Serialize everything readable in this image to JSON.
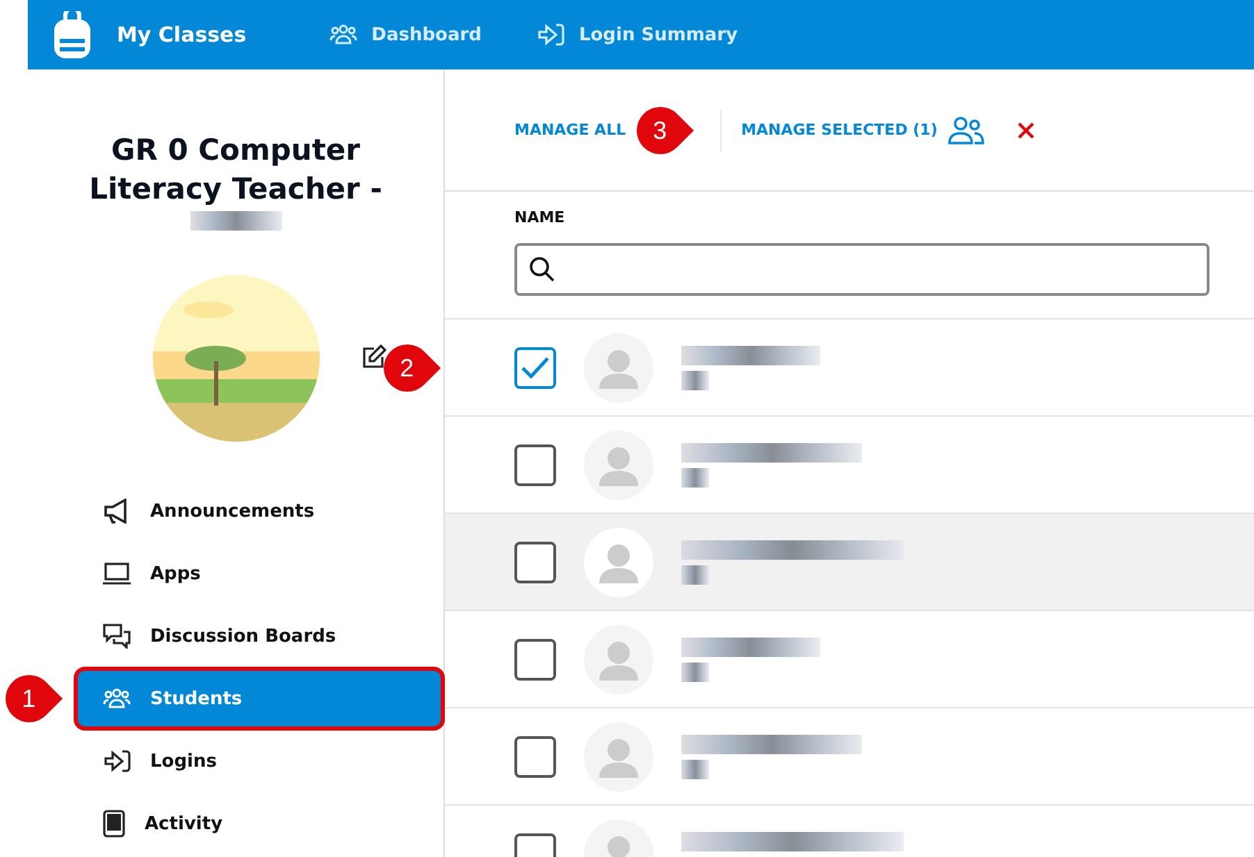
{
  "top_nav": {
    "title": "My Classes",
    "links": [
      {
        "label": "Dashboard"
      },
      {
        "label": "Login Summary"
      }
    ]
  },
  "sidebar": {
    "class_title": "GR 0 Computer Literacy Teacher -",
    "items": [
      {
        "label": "Announcements",
        "selected": false
      },
      {
        "label": "Apps",
        "selected": false
      },
      {
        "label": "Discussion Boards",
        "selected": false
      },
      {
        "label": "Students",
        "selected": true,
        "callout": "1"
      },
      {
        "label": "Logins",
        "selected": false
      },
      {
        "label": "Activity",
        "selected": false
      }
    ]
  },
  "toolbar": {
    "manage_all": "MANAGE ALL",
    "manage_selected": "MANAGE SELECTED (1)",
    "callout": "3"
  },
  "table": {
    "column": "NAME",
    "rows": [
      {
        "checked": true,
        "highlighted": false,
        "callout": "2"
      },
      {
        "checked": false,
        "highlighted": false
      },
      {
        "checked": false,
        "highlighted": true
      },
      {
        "checked": false,
        "highlighted": false
      },
      {
        "checked": false,
        "highlighted": false
      },
      {
        "checked": false,
        "highlighted": false
      }
    ]
  }
}
